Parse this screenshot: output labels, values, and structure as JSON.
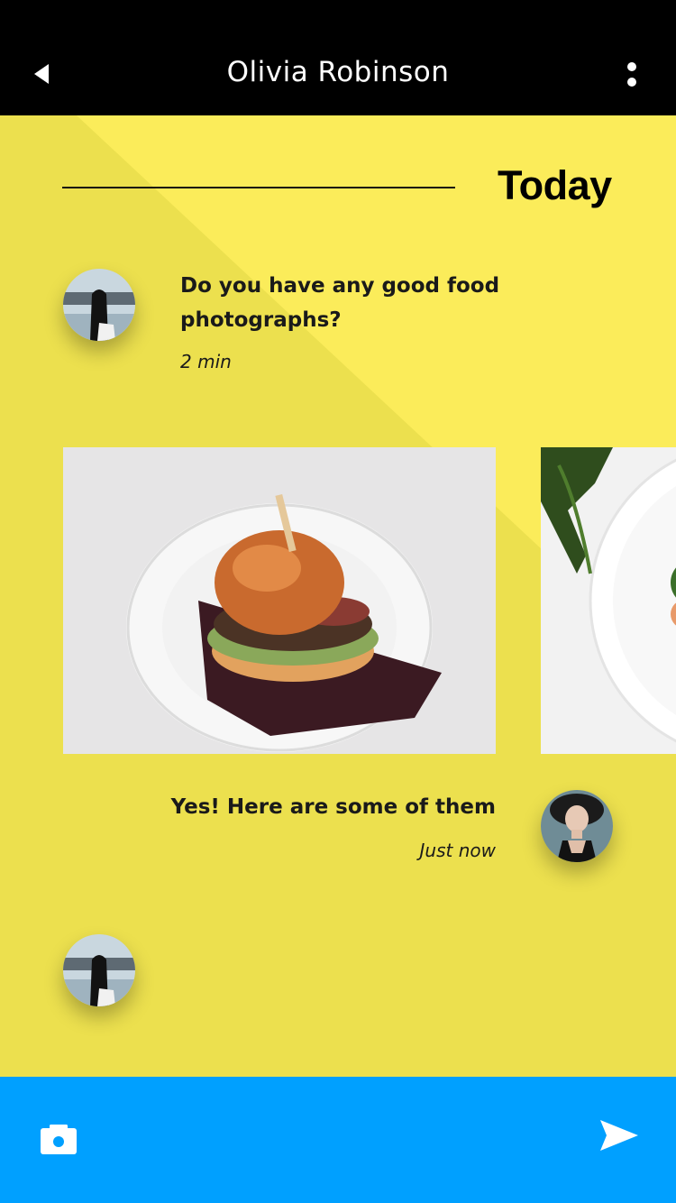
{
  "header": {
    "title": "Olivia Robinson",
    "back_icon": "back-arrow-icon",
    "menu_icon": "more-vertical-icon"
  },
  "colors": {
    "header_bg": "#000000",
    "content_bg": "#ece04e",
    "content_bg_light": "#fbec5a",
    "footer_bg": "#00a0ff"
  },
  "conversation": {
    "date_separator": "Today",
    "messages": [
      {
        "sender": "other",
        "text": "Do you have any good food photographs?",
        "time": "2 min"
      },
      {
        "sender": "me",
        "text": "Yes! Here are some of them",
        "time": "Just now"
      }
    ],
    "attachments": [
      {
        "subject": "burger-photo"
      },
      {
        "subject": "salad-photo"
      }
    ]
  },
  "footer": {
    "camera_icon": "camera-icon",
    "send_icon": "send-icon"
  }
}
